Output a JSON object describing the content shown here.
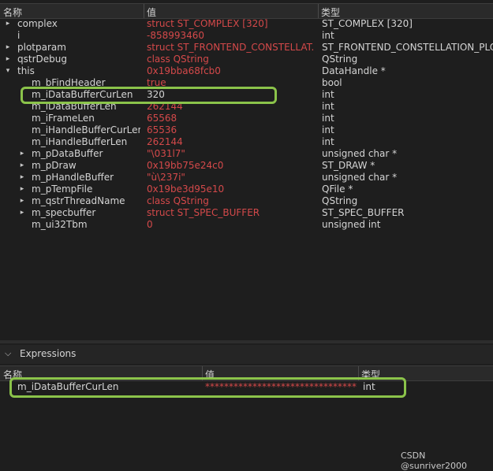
{
  "locals": {
    "headers": {
      "name": "名称",
      "value": "值",
      "type": "类型"
    },
    "rows": [
      {
        "name": "complex",
        "value": "struct ST_COMPLEX [320]",
        "type": "ST_COMPLEX [320]",
        "expand": "collapsed",
        "depth": 0,
        "value_style": "accent"
      },
      {
        "name": "i",
        "value": "-858993460",
        "type": "int",
        "expand": "none",
        "depth": 0,
        "value_style": "accent"
      },
      {
        "name": "plotparam",
        "value": "struct ST_FRONTEND_CONSTELLAT...",
        "type": "ST_FRONTEND_CONSTELLATION_PLO",
        "expand": "collapsed",
        "depth": 0,
        "value_style": "accent"
      },
      {
        "name": "qstrDebug",
        "value": "class QString",
        "type": "QString",
        "expand": "collapsed",
        "depth": 0,
        "value_style": "accent"
      },
      {
        "name": "this",
        "value": "0x19bba68fcb0",
        "type": "DataHandle *",
        "expand": "expanded",
        "depth": 0,
        "value_style": "accent"
      },
      {
        "name": "m_bFindHeader",
        "value": "true",
        "type": "bool",
        "expand": "none",
        "depth": 1,
        "value_style": "accent"
      },
      {
        "name": "m_iDataBufferCurLen",
        "value": "320",
        "type": "int",
        "expand": "none",
        "depth": 1,
        "value_style": "plain"
      },
      {
        "name": "m_iDataBufferLen",
        "value": "262144",
        "type": "int",
        "expand": "none",
        "depth": 1,
        "value_style": "accent"
      },
      {
        "name": "m_iFrameLen",
        "value": "65568",
        "type": "int",
        "expand": "none",
        "depth": 1,
        "value_style": "accent"
      },
      {
        "name": "m_iHandleBufferCurLen",
        "value": "65536",
        "type": "int",
        "expand": "none",
        "depth": 1,
        "value_style": "accent"
      },
      {
        "name": "m_iHandleBufferLen",
        "value": "262144",
        "type": "int",
        "expand": "none",
        "depth": 1,
        "value_style": "accent"
      },
      {
        "name": "m_pDataBuffer",
        "value": "\"\\031l7\"",
        "type": "unsigned char *",
        "expand": "collapsed",
        "depth": 1,
        "value_style": "accent"
      },
      {
        "name": "m_pDraw",
        "value": "0x19bb75e24c0",
        "type": "ST_DRAW *",
        "expand": "collapsed",
        "depth": 1,
        "value_style": "accent"
      },
      {
        "name": "m_pHandleBuffer",
        "value": "\"ù\\237i\"",
        "type": "unsigned char *",
        "expand": "collapsed",
        "depth": 1,
        "value_style": "accent"
      },
      {
        "name": "m_pTempFile",
        "value": "0x19be3d95e10",
        "type": "QFile *",
        "expand": "collapsed",
        "depth": 1,
        "value_style": "accent"
      },
      {
        "name": "m_qstrThreadName",
        "value": "class QString",
        "type": "QString",
        "expand": "collapsed",
        "depth": 1,
        "value_style": "accent"
      },
      {
        "name": "m_specbuffer",
        "value": "struct ST_SPEC_BUFFER",
        "type": "ST_SPEC_BUFFER",
        "expand": "collapsed",
        "depth": 1,
        "value_style": "accent"
      },
      {
        "name": "m_ui32Tbm",
        "value": "0",
        "type": "unsigned int",
        "expand": "none",
        "depth": 1,
        "value_style": "accent"
      }
    ]
  },
  "expressions": {
    "title": "Expressions",
    "headers": {
      "name": "名称",
      "value": "值",
      "type": "类型"
    },
    "rows": [
      {
        "name": "m_iDataBufferCurLen",
        "value": "*********************************** ...",
        "type": "int"
      }
    ]
  },
  "watermark": "CSDN @sunriver2000",
  "colors": {
    "accent_value": "#d4494a",
    "highlight": "#8bc34a",
    "background": "#1e1e1e"
  }
}
